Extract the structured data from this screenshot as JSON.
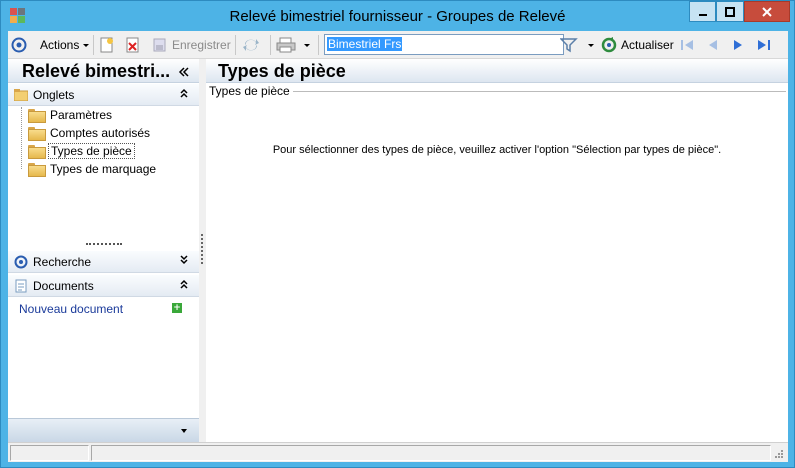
{
  "window": {
    "title": "Relevé bimestriel fournisseur -  Groupes de Relevé"
  },
  "toolbar": {
    "actions_label": "Actions",
    "save_label": "Enregistrer",
    "search_value": "Bimestriel Frs",
    "refresh_label": "Actualiser"
  },
  "left_panel": {
    "title": "Relevé bimestri...",
    "sections": {
      "onglets": "Onglets",
      "recherche": "Recherche",
      "documents": "Documents"
    },
    "tree": [
      {
        "label": "Paramètres"
      },
      {
        "label": "Comptes autorisés"
      },
      {
        "label": "Types de pièce"
      },
      {
        "label": "Types de marquage"
      }
    ],
    "new_document": "Nouveau document"
  },
  "main_panel": {
    "title": "Types de pièce",
    "group_label": "Types de pièce",
    "message": "Pour sélectionner des types de pièce, veuillez activer l'option \"Sélection par types de pièce\"."
  },
  "colors": {
    "frame": "#4db3e6",
    "close_button": "#c74c3c",
    "selection": "#3399ff"
  }
}
